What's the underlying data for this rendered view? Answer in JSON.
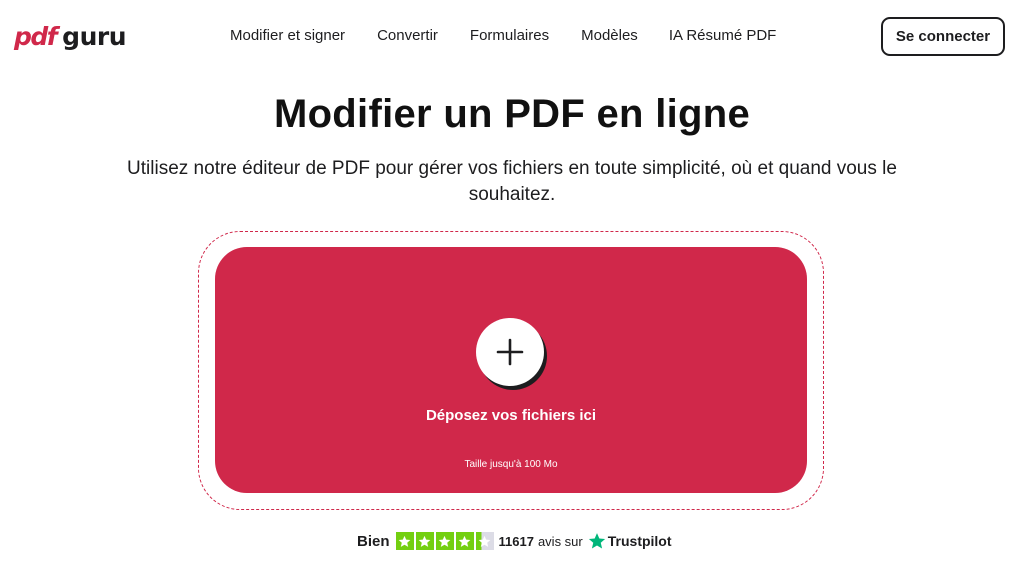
{
  "brand": {
    "logo_pdf": "pdf",
    "logo_guru": "guru",
    "accent_color": "#d0284a"
  },
  "nav": {
    "items": [
      {
        "label": "Modifier et signer"
      },
      {
        "label": "Convertir"
      },
      {
        "label": "Formulaires"
      },
      {
        "label": "Modèles"
      },
      {
        "label": "IA Résumé PDF"
      }
    ],
    "login_label": "Se connecter"
  },
  "hero": {
    "title": "Modifier un PDF en ligne",
    "subtitle": "Utilisez notre éditeur de PDF pour gérer vos fichiers en toute simplicité, où et quand vous le souhaitez."
  },
  "upload": {
    "icon": "plus-icon",
    "label": "Déposez vos fichiers ici",
    "size_note": "Taille jusqu'à 100 Mo"
  },
  "rating": {
    "word": "Bien",
    "stars_value": 4.3,
    "stars_max": 5,
    "reviews_count": "11617",
    "reviews_text": "avis sur",
    "provider": "Trustpilot",
    "star_color": "#73cf11",
    "provider_star_color": "#00b67a"
  }
}
